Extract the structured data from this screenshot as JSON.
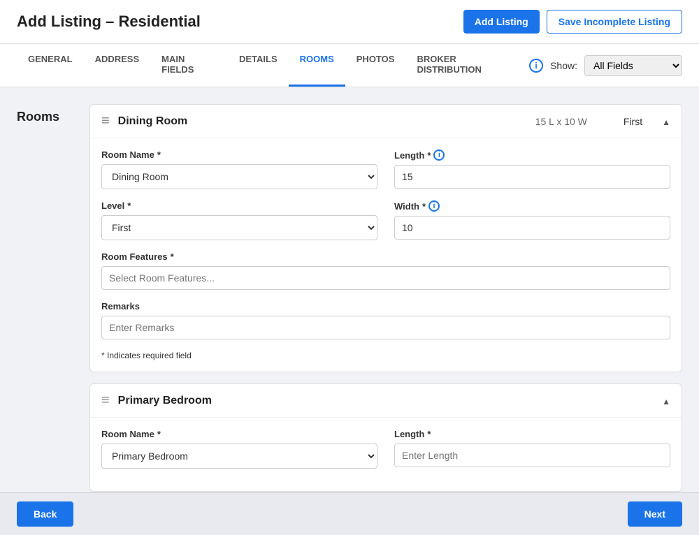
{
  "page": {
    "title": "Add Listing – Residential"
  },
  "header": {
    "add_listing_label": "Add Listing",
    "save_incomplete_label": "Save Incomplete Listing"
  },
  "nav": {
    "tabs": [
      {
        "id": "general",
        "label": "GENERAL",
        "active": false
      },
      {
        "id": "address",
        "label": "ADDRESS",
        "active": false
      },
      {
        "id": "main_fields",
        "label": "MAIN FIELDS",
        "active": false
      },
      {
        "id": "details",
        "label": "DETAILS",
        "active": false
      },
      {
        "id": "rooms",
        "label": "ROOMS",
        "active": true
      },
      {
        "id": "photos",
        "label": "PHOTOS",
        "active": false
      },
      {
        "id": "broker_distribution",
        "label": "BROKER DISTRIBUTION",
        "active": false
      }
    ],
    "show_label": "Show:",
    "show_options": [
      "All Fields"
    ],
    "show_selected": "All Fields"
  },
  "sidebar": {
    "label": "Rooms"
  },
  "rooms": [
    {
      "id": "dining_room",
      "name": "Dining Room",
      "dims": "15 L x 10 W",
      "level": "First",
      "expanded": true,
      "fields": {
        "room_name_label": "Room Name",
        "room_name_value": "Dining Room",
        "level_label": "Level",
        "level_value": "First",
        "room_features_label": "Room Features",
        "room_features_placeholder": "Select Room Features...",
        "remarks_label": "Remarks",
        "remarks_placeholder": "Enter Remarks",
        "length_label": "Length",
        "length_value": "15",
        "width_label": "Width",
        "width_value": "10"
      },
      "required_note": "* Indicates required field"
    },
    {
      "id": "primary_bedroom",
      "name": "Primary Bedroom",
      "dims": "",
      "level": "",
      "expanded": true,
      "fields": {
        "room_name_label": "Room Name",
        "room_name_value": "Primary Bedroom",
        "length_label": "Length",
        "length_value": "",
        "length_placeholder": "Enter Length"
      }
    }
  ],
  "footer": {
    "back_label": "Back",
    "next_label": "Next"
  },
  "icons": {
    "info": "ℹ",
    "chevron_up": "▲",
    "drag": "≡"
  }
}
